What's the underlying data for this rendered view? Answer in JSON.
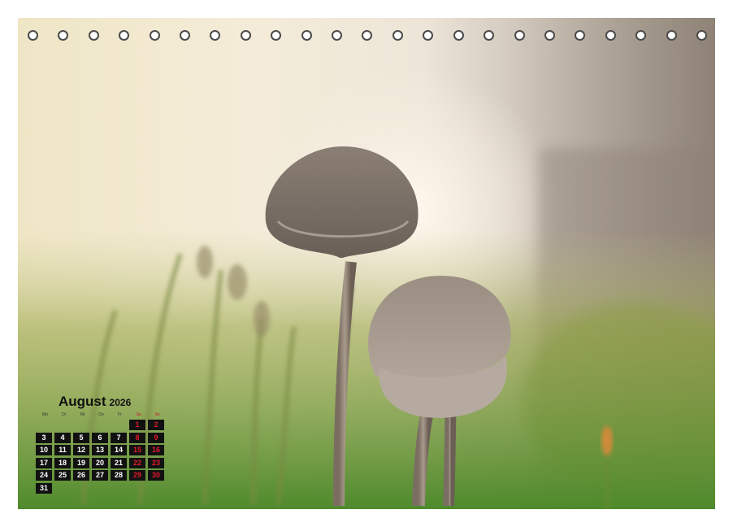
{
  "calendar": {
    "month": "August",
    "year": "2026",
    "weekdays": [
      "Mo",
      "Di",
      "Mi",
      "Do",
      "Fr",
      "Sa",
      "So"
    ],
    "start_weekday_index": 5,
    "days_in_month": 31,
    "weekend_color": "#e21a2c",
    "cell_color": "#111111"
  },
  "binding": {
    "ring_count": 23
  },
  "photo": {
    "subject": "two-mushrooms-in-moss"
  }
}
